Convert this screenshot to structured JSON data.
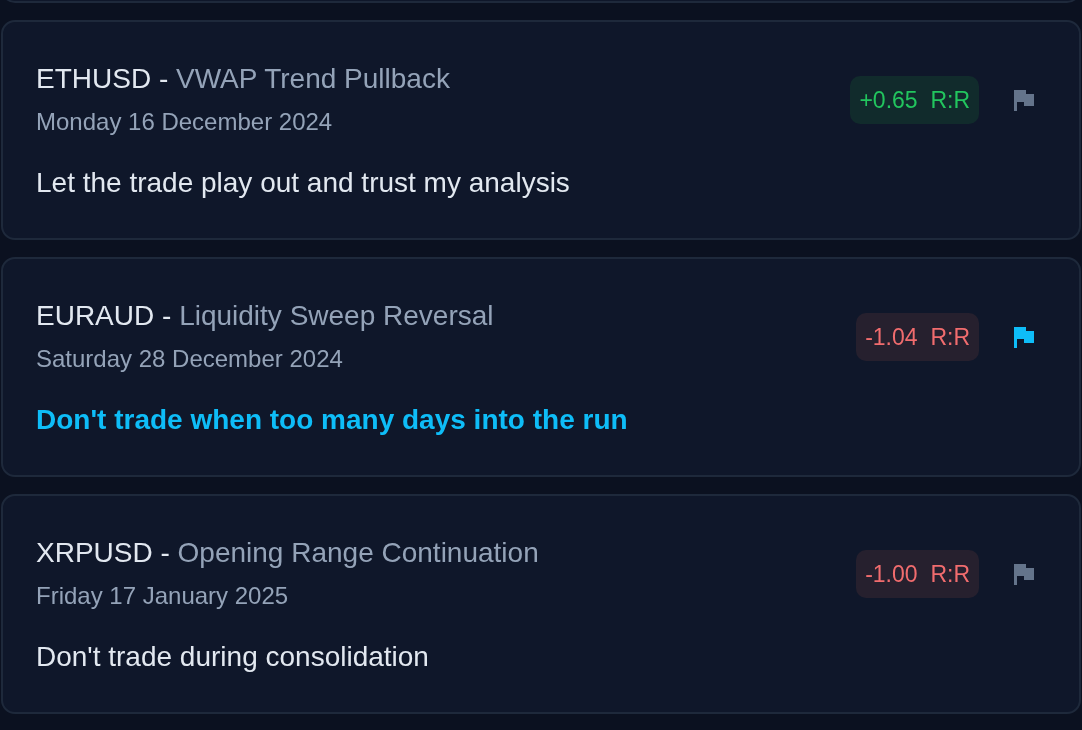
{
  "trades": [
    {
      "symbol": "ETHUSD",
      "separator": "-",
      "strategy": "VWAP Trend Pullback",
      "date": "Monday 16 December 2024",
      "kind": "gain",
      "rr_value": "+0.65",
      "rr_unit": "R:R",
      "flagged": false,
      "note": "Let the trade play out and trust my analysis"
    },
    {
      "symbol": "EURAUD",
      "separator": "-",
      "strategy": "Liquidity Sweep Reversal",
      "date": "Saturday 28 December 2024",
      "kind": "loss",
      "rr_value": "-1.04",
      "rr_unit": "R:R",
      "flagged": true,
      "note": "Don't trade when too many days into the run"
    },
    {
      "symbol": "XRPUSD",
      "separator": "-",
      "strategy": "Opening Range Continuation",
      "date": "Friday 17 January 2025",
      "kind": "loss",
      "rr_value": "-1.00",
      "rr_unit": "R:R",
      "flagged": false,
      "note": "Don't trade during consolidation"
    }
  ]
}
